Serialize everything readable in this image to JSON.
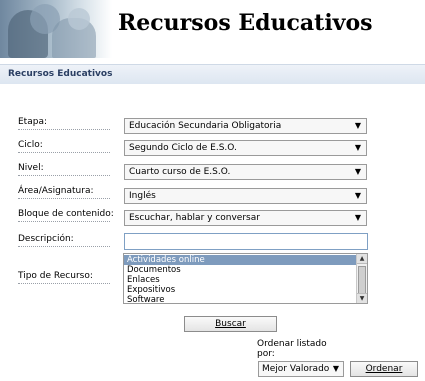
{
  "header": {
    "title": "Recursos Educativos"
  },
  "section": {
    "title": "Recursos Educativos"
  },
  "form": {
    "etapa": {
      "label": "Etapa:",
      "value": "Educación Secundaria Obligatoria"
    },
    "ciclo": {
      "label": "Ciclo:",
      "value": "Segundo Ciclo de E.S.O."
    },
    "nivel": {
      "label": "Nivel:",
      "value": "Cuarto curso de E.S.O."
    },
    "area": {
      "label": "Área/Asignatura:",
      "value": "Inglés"
    },
    "bloque": {
      "label": "Bloque de contenido:",
      "value": "Escuchar, hablar y conversar"
    },
    "descripcion": {
      "label": "Descripción:",
      "value": ""
    },
    "tipo": {
      "label": "Tipo de Recurso:",
      "options": [
        "Actividades online",
        "Documentos",
        "Enlaces",
        "Expositivos",
        "Software"
      ],
      "selected": "Actividades online"
    }
  },
  "buttons": {
    "buscar": "Buscar",
    "ordenar": "Ordenar"
  },
  "order": {
    "label": "Ordenar listado por:",
    "value": "Mejor Valorado"
  },
  "icons": {
    "dropdown": "triangle-down-icon",
    "scroll_up": "triangle-up-icon",
    "scroll_down": "triangle-down-icon"
  }
}
